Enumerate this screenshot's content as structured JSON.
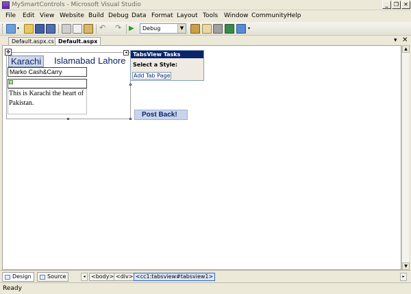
{
  "window": {
    "title": "MySmartControls - Microsoft Visual Studio"
  },
  "caption_buttons": {
    "minimize": "_",
    "restore": "❐",
    "close": "✕"
  },
  "menu": [
    "File",
    "Edit",
    "View",
    "Website",
    "Build",
    "Debug",
    "Data",
    "Format",
    "Layout",
    "Tools",
    "Window",
    "Community",
    "Help"
  ],
  "toolbar": {
    "configuration": "Debug"
  },
  "doc_tabs": {
    "tab1": "Default.aspx.cs",
    "tab2": "Default.aspx"
  },
  "tabsview": {
    "tabs": [
      "Karachi",
      "Islamabad",
      "Lahore"
    ],
    "textbox_value": "Marko Cash&Carry",
    "paragraph": "This is Karachi the heart of Pakistan."
  },
  "tasks_panel": {
    "title": "TabsView Tasks",
    "label": "Select a Style:",
    "link": "Add Tab Page"
  },
  "postback": {
    "label": "Post Back!"
  },
  "view_tabs": {
    "design": "Design",
    "source": "Source"
  },
  "breadcrumb": [
    "<body>",
    "<div>",
    "<cc1:tabsview#tabsview1>"
  ],
  "status": {
    "text": "Ready"
  },
  "colors": {
    "selection": "#0a246a",
    "surface": "#ffffff",
    "chrome": "#ece9d8"
  }
}
